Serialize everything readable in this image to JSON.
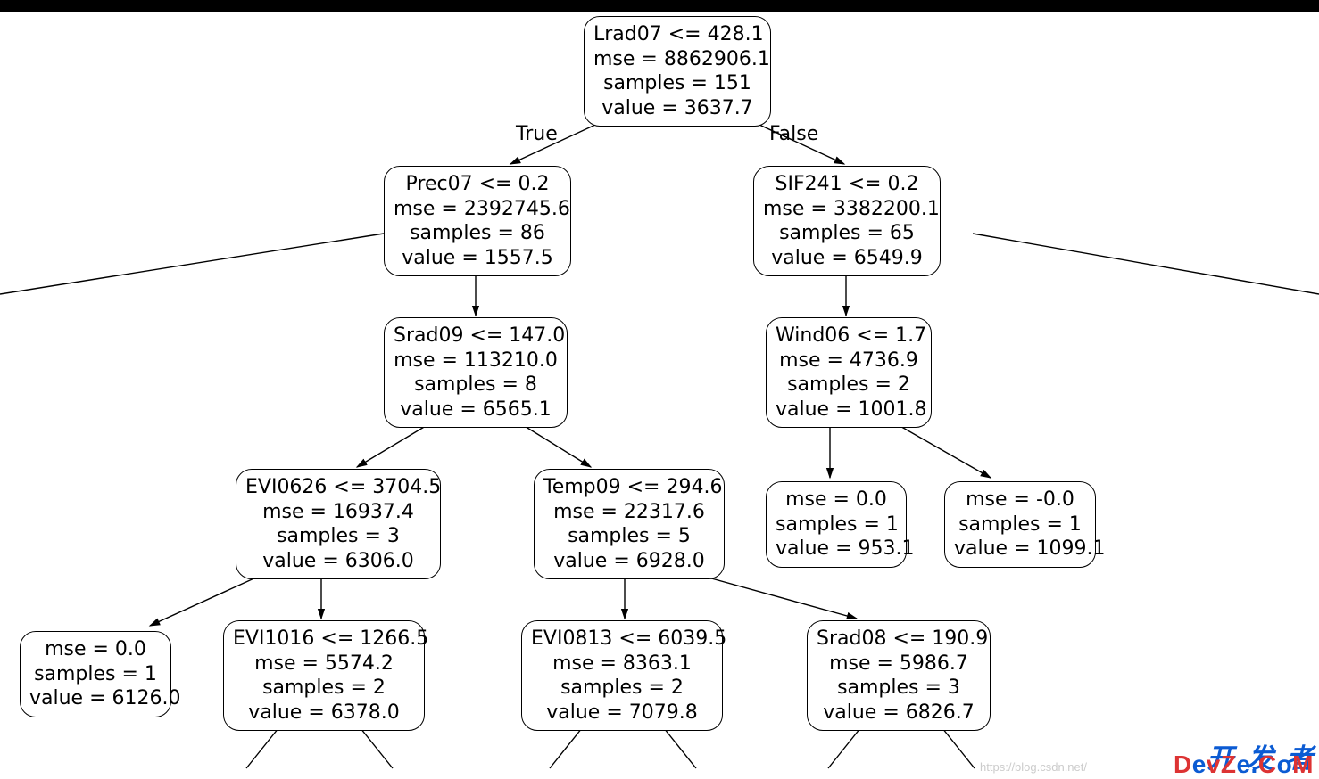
{
  "labels": {
    "true": "True",
    "false": "False"
  },
  "tree": {
    "root": {
      "cond": "Lrad07 <= 428.1",
      "mse": "mse = 8862906.1",
      "samp": "samples = 151",
      "val": "value = 3637.7"
    },
    "l": {
      "cond": "Prec07 <= 0.2",
      "mse": "mse = 2392745.6",
      "samp": "samples = 86",
      "val": "value = 1557.5"
    },
    "r": {
      "cond": "SIF241 <= 0.2",
      "mse": "mse = 3382200.1",
      "samp": "samples = 65",
      "val": "value = 6549.9"
    },
    "l_c": {
      "cond": "Srad09 <= 147.0",
      "mse": "mse = 113210.0",
      "samp": "samples = 8",
      "val": "value = 6565.1"
    },
    "r_c": {
      "cond": "Wind06 <= 1.7",
      "mse": "mse = 4736.9",
      "samp": "samples = 2",
      "val": "value = 1001.8"
    },
    "l_c_l": {
      "cond": "EVI0626 <= 3704.5",
      "mse": "mse = 16937.4",
      "samp": "samples = 3",
      "val": "value = 6306.0"
    },
    "l_c_r": {
      "cond": "Temp09 <= 294.6",
      "mse": "mse = 22317.6",
      "samp": "samples = 5",
      "val": "value = 6928.0"
    },
    "r_c_l": {
      "mse": "mse = 0.0",
      "samp": "samples = 1",
      "val": "value = 953.1"
    },
    "r_c_r": {
      "mse": "mse = -0.0",
      "samp": "samples = 1",
      "val": "value = 1099.1"
    },
    "ll_leaf": {
      "mse": "mse = 0.0",
      "samp": "samples = 1",
      "val": "value = 6126.0"
    },
    "ll_r": {
      "cond": "EVI1016 <= 1266.5",
      "mse": "mse = 5574.2",
      "samp": "samples = 2",
      "val": "value = 6378.0"
    },
    "lr_l": {
      "cond": "EVI0813 <= 6039.5",
      "mse": "mse = 8363.1",
      "samp": "samples = 2",
      "val": "value = 7079.8"
    },
    "lr_r": {
      "cond": "Srad08 <= 190.9",
      "mse": "mse = 5986.7",
      "samp": "samples = 3",
      "val": "value = 6826.7"
    }
  },
  "watermark": {
    "cn1": "开",
    "cn2": "发",
    "cn3": "者",
    "en": "DevZe.CoM",
    "csdn": "https://blog.csdn.net/"
  }
}
